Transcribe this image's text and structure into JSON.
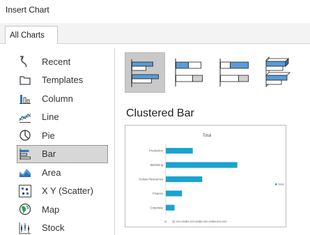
{
  "dialog": {
    "title": "Insert Chart"
  },
  "tabs": [
    {
      "label": "All Charts"
    }
  ],
  "categories": [
    {
      "label": "Recent",
      "icon": "recent-icon"
    },
    {
      "label": "Templates",
      "icon": "templates-icon"
    },
    {
      "label": "Column",
      "icon": "column-chart-icon"
    },
    {
      "label": "Line",
      "icon": "line-chart-icon"
    },
    {
      "label": "Pie",
      "icon": "pie-chart-icon"
    },
    {
      "label": "Bar",
      "icon": "bar-chart-icon",
      "selected": true
    },
    {
      "label": "Area",
      "icon": "area-chart-icon"
    },
    {
      "label": "X Y (Scatter)",
      "icon": "scatter-chart-icon"
    },
    {
      "label": "Map",
      "icon": "map-chart-icon"
    },
    {
      "label": "Stock",
      "icon": "stock-chart-icon"
    }
  ],
  "subtypes": [
    {
      "name": "Clustered Bar",
      "selected": true
    },
    {
      "name": "Stacked Bar"
    },
    {
      "name": "100% Stacked Bar"
    },
    {
      "name": "3-D Clustered Bar"
    },
    {
      "name": "3-D Stacked Bar"
    }
  ],
  "selected_subtype_title": "Clustered Bar",
  "colors": {
    "accent": "#2e75b6",
    "bar": "#1aa3cf",
    "selection": "#c9c9c9"
  },
  "chart_data": {
    "type": "bar",
    "orientation": "horizontal",
    "title": "Total",
    "categories": [
      "Production",
      "Marketing",
      "Human Resources",
      "Finance",
      "Corporate"
    ],
    "series": [
      {
        "name": "Total",
        "values": [
          2000000,
          5300000,
          2700000,
          1200000,
          650000
        ]
      }
    ],
    "xlim": [
      0,
      8000000
    ],
    "x_ticks": [
      "$-",
      "$1,000,000",
      "$2,000,000",
      "$3,000,000",
      "$4,000,000"
    ],
    "legend": "right",
    "grid": false
  }
}
